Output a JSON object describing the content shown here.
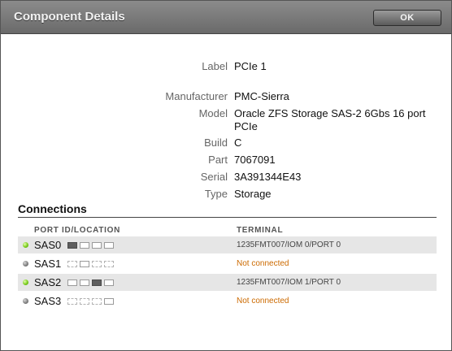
{
  "dialog": {
    "title": "Component Details",
    "ok_label": "OK"
  },
  "details": [
    {
      "label": "Label",
      "value": "PCIe 1"
    },
    {
      "label": "Manufacturer",
      "value": "PMC-Sierra"
    },
    {
      "label": "Model",
      "value": "Oracle ZFS Storage SAS-2 6Gbs 16 port PCIe"
    },
    {
      "label": "Build",
      "value": "C"
    },
    {
      "label": "Part",
      "value": "7067091"
    },
    {
      "label": "Serial",
      "value": "3A391344E43"
    },
    {
      "label": "Type",
      "value": "Storage"
    }
  ],
  "connections": {
    "heading": "Connections",
    "columns": {
      "port": "PORT ID/LOCATION",
      "terminal": "TERMINAL"
    },
    "rows": [
      {
        "status": "green",
        "port": "SAS0",
        "terminal": "1235FMT007/IOM 0/PORT 0"
      },
      {
        "status": "gray",
        "port": "SAS1",
        "terminal": "Not connected"
      },
      {
        "status": "green",
        "port": "SAS2",
        "terminal": "1235FMT007/IOM 1/PORT 0"
      },
      {
        "status": "gray",
        "port": "SAS3",
        "terminal": "Not connected"
      }
    ]
  },
  "colors": {
    "connected": "#7ccd1e",
    "disconnected": "#7d7d7d",
    "not_connected_text": "#cc6a00"
  }
}
